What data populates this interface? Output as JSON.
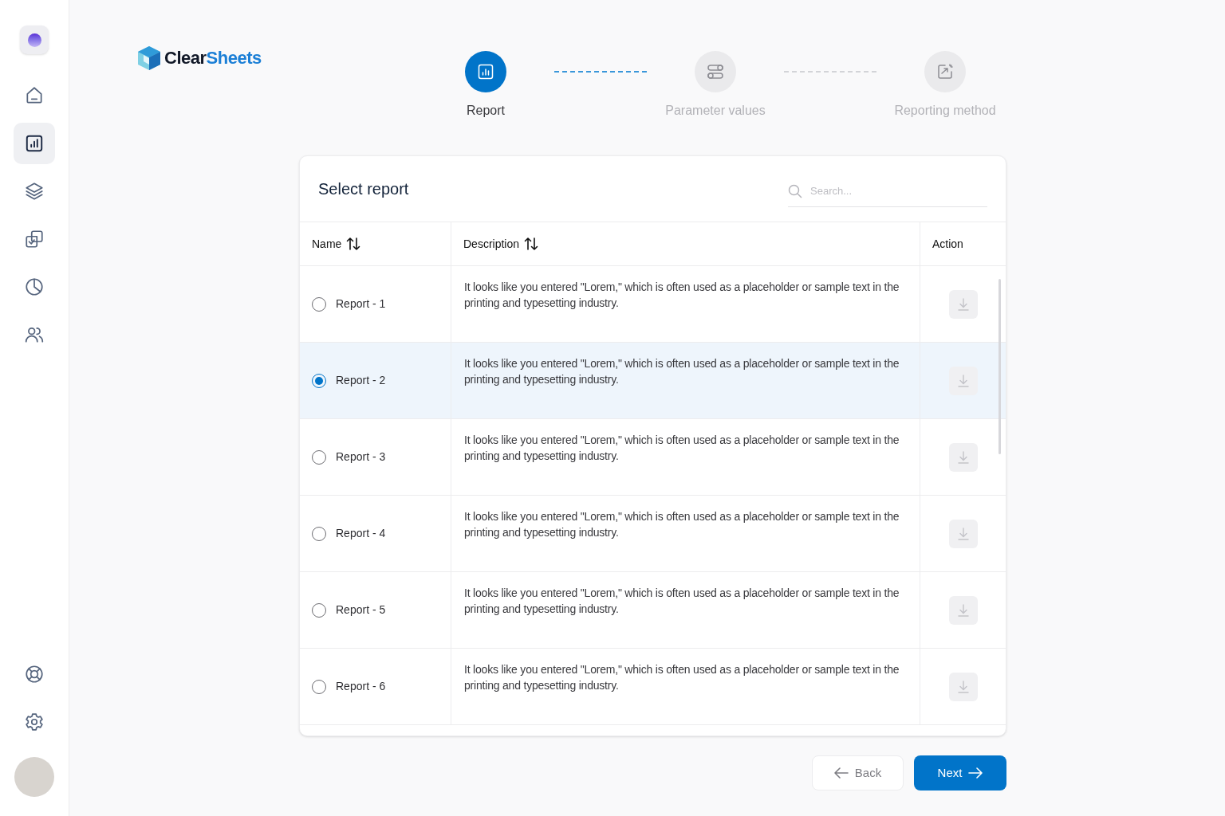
{
  "sidebar": {
    "items": [
      {
        "kind": "home",
        "selected": false
      },
      {
        "kind": "reports",
        "selected": true
      },
      {
        "kind": "layers",
        "selected": false
      },
      {
        "kind": "tasks",
        "selected": false
      },
      {
        "kind": "pie",
        "selected": false
      },
      {
        "kind": "users",
        "selected": false
      }
    ],
    "bottom_items": [
      {
        "kind": "support",
        "selected": false
      },
      {
        "kind": "settings",
        "selected": false
      }
    ]
  },
  "logo": {
    "part_1": "Clear",
    "part_2": "Sheets"
  },
  "steps": [
    {
      "label": "Report",
      "kind": "report",
      "selected": true
    },
    {
      "label": "Parameter values",
      "kind": "params",
      "selected": false
    },
    {
      "label": "Reporting method",
      "kind": "method",
      "selected": false
    }
  ],
  "card": {
    "title": "Select report",
    "search": {
      "placeholder": "Search..."
    }
  },
  "table": {
    "columns": [
      {
        "label": "Name",
        "sortable": true
      },
      {
        "label": "Description",
        "sortable": true
      },
      {
        "label": "Action",
        "sortable": false
      }
    ],
    "rows": [
      {
        "name": "Report - 1",
        "description": "It looks like you entered \"Lorem,\" which is often used as a placeholder or sample text in the printing and typesetting industry.",
        "selected": false
      },
      {
        "name": "Report - 2",
        "description": "It looks like you entered \"Lorem,\" which is often used as a placeholder or sample text in the printing and typesetting industry.",
        "selected": true
      },
      {
        "name": "Report - 3",
        "description": "It looks like you entered \"Lorem,\" which is often used as a placeholder or sample text in the printing and typesetting industry.",
        "selected": false
      },
      {
        "name": "Report - 4",
        "description": "It looks like you entered \"Lorem,\" which is often used as a placeholder or sample text in the printing and typesetting industry.",
        "selected": false
      },
      {
        "name": "Report - 5",
        "description": "It looks like you entered \"Lorem,\" which is often used as a placeholder or sample text in the printing and typesetting industry.",
        "selected": false
      },
      {
        "name": "Report - 6",
        "description": "It looks like you entered \"Lorem,\" which is often used as a placeholder or sample text in the printing and typesetting industry.",
        "selected": false
      }
    ]
  },
  "buttons": {
    "back": "Back",
    "next": "Next"
  }
}
